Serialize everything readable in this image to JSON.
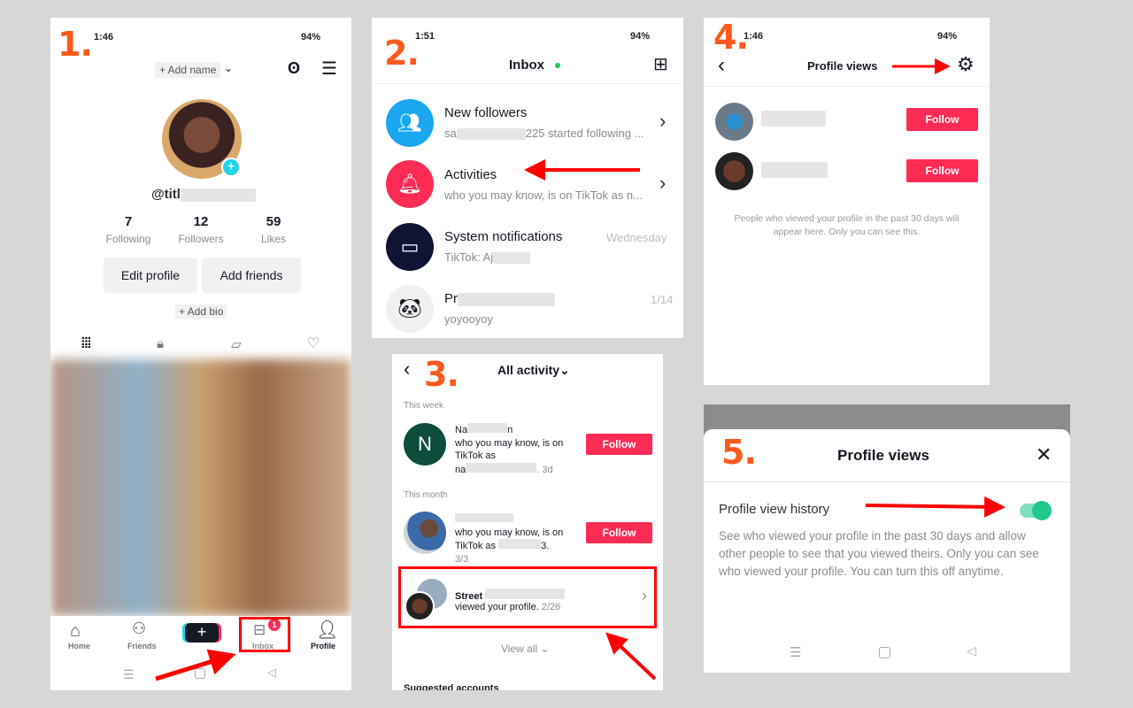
{
  "steps": [
    "1.",
    "2.",
    "3.",
    "4.",
    "5."
  ],
  "colors": {
    "accent": "#fe2c55",
    "step_label": "#fe5a1d",
    "annotation": "#ff0000",
    "toggle": "#20c98b"
  },
  "status_bar": {
    "p1_time": "1:46",
    "p2_time": "1:51",
    "p4_time": "1:46",
    "battery": "94%"
  },
  "profile": {
    "add_name": "+ Add name",
    "username": "@titl",
    "stats": [
      {
        "value": "7",
        "label": "Following"
      },
      {
        "value": "12",
        "label": "Followers"
      },
      {
        "value": "59",
        "label": "Likes"
      }
    ],
    "edit_profile": "Edit profile",
    "add_friends": "Add friends",
    "add_bio": "+ Add bio",
    "tabs": [
      "grid-icon",
      "lock-icon",
      "tagged-icon",
      "liked-icon"
    ],
    "nav": [
      {
        "label": "Home",
        "icon": "home-icon"
      },
      {
        "label": "Friends",
        "icon": "friends-icon"
      },
      {
        "label": "",
        "icon": "create-icon"
      },
      {
        "label": "Inbox",
        "icon": "inbox-icon",
        "badge": "1"
      },
      {
        "label": "Profile",
        "icon": "profile-icon"
      }
    ]
  },
  "inbox": {
    "title": "Inbox",
    "items": [
      {
        "title": "New followers",
        "subtitle": "sa",
        "subtitle_end": "225 started following ...",
        "icon": "followers-icon",
        "color": "#1ba7ef"
      },
      {
        "title": "Activities",
        "subtitle": "who you may know, is on TikTok as n...",
        "icon": "bell-icon",
        "color": "#fe2c55"
      },
      {
        "title": "System notifications",
        "subtitle": "TikTok: Aj",
        "time": "Wednesday",
        "icon": "inbox-box-icon",
        "color": "#0f1434"
      },
      {
        "title": "Pr",
        "subtitle": "yoyooyoy",
        "time": "1/14",
        "icon": "panda-avatar",
        "color": "#f0f0f0"
      }
    ]
  },
  "activity": {
    "title": "All activity",
    "this_week": "This week",
    "this_month": "This month",
    "items": [
      {
        "name": "Na",
        "name_end": "n",
        "line1": "who you may know, is on",
        "line2": "TikTok as",
        "line3": "na",
        "time": ". 3d",
        "avatar_letter": "N",
        "follow": "Follow"
      },
      {
        "line1": "who you may know, is on",
        "line2": "TikTok as",
        "line2_end": "3.",
        "time": "3/3",
        "follow": "Follow"
      },
      {
        "name": "Street",
        "line1": "viewed your profile.",
        "time": "2/26"
      }
    ],
    "view_all": "View all",
    "suggested": "Suggested accounts"
  },
  "profile_views": {
    "title": "Profile views",
    "follow": "Follow",
    "note": "People who viewed your profile in the past 30 days will appear here. Only you can see this."
  },
  "settings": {
    "title": "Profile views",
    "toggle_label": "Profile view history",
    "toggle_on": true,
    "description": "See who viewed your profile in the past 30 days and allow other people to see that you viewed theirs. Only you can see who viewed your profile. You can turn this off anytime."
  }
}
